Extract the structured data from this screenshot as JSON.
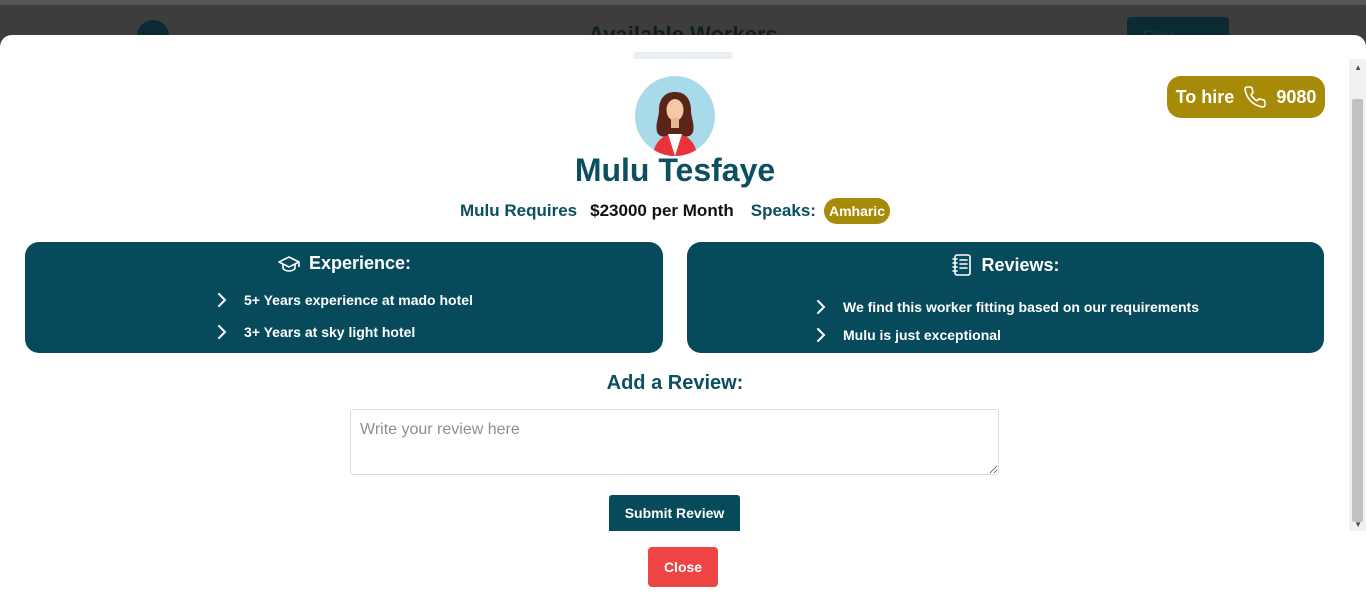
{
  "background": {
    "title": "Available Workers",
    "filter_label": "Filter"
  },
  "hire": {
    "label": "To hire",
    "phone_icon": "phone-icon",
    "number": "9080"
  },
  "worker": {
    "name": "Mulu Tesfaye",
    "requires_label": "Mulu Requires",
    "salary": "$23000 per Month",
    "speaks_label": "Speaks:",
    "language": "Amharic"
  },
  "experience": {
    "icon": "graduation-cap-icon",
    "title": "Experience:",
    "items": [
      "5+ Years experience at mado hotel",
      "3+ Years at sky light hotel"
    ]
  },
  "reviews": {
    "icon": "notebook-icon",
    "title": "Reviews:",
    "items": [
      "We find this worker fitting based on our requirements",
      "Mulu is just exceptional"
    ]
  },
  "add_review": {
    "title": "Add a Review:",
    "placeholder": "Write your review here",
    "submit_label": "Submit Review"
  },
  "close_label": "Close",
  "colors": {
    "primary": "#064a5b",
    "accent": "#a88a09",
    "danger": "#ef4444"
  }
}
